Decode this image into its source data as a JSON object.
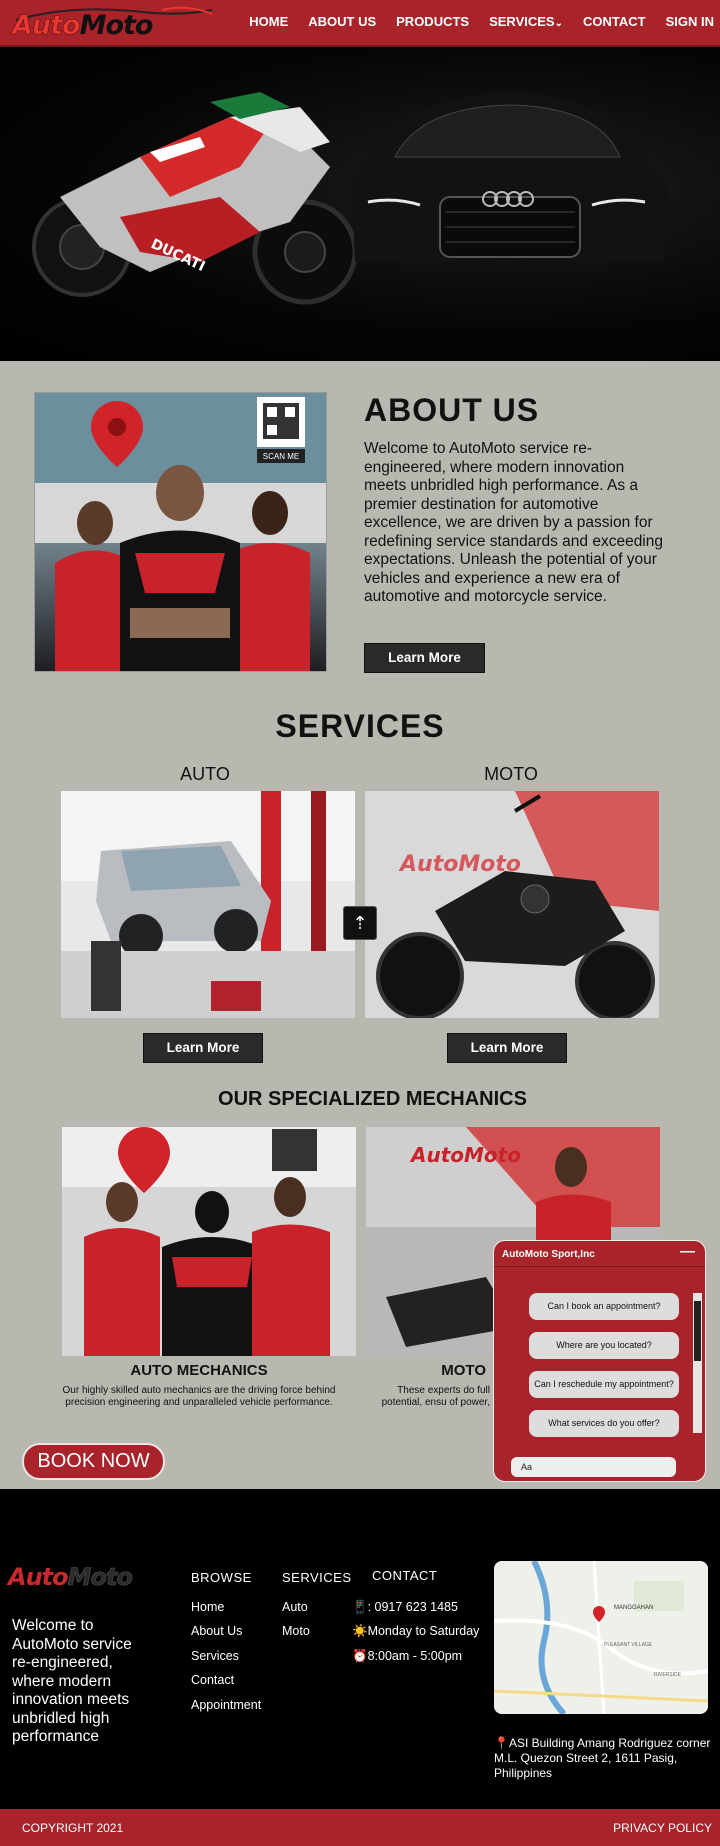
{
  "brand": {
    "part1": "Auto",
    "part2": "Moto"
  },
  "nav": {
    "items": [
      "HOME",
      "ABOUT US",
      "PRODUCTS",
      "SERVICES",
      "CONTACT",
      "SIGN IN"
    ],
    "services_caret": "⌄"
  },
  "about": {
    "title": "ABOUT US",
    "text": "Welcome to AutoMoto service re-engineered, where modern innovation meets unbridled high performance. As a premier destination for automotive excellence, we are driven by a passion for redefining service standards and exceeding expectations. Unleash the potential of your vehicles and experience a new era of automotive and motorcycle service.",
    "button": "Learn More",
    "photo_qr_label": "SCAN ME"
  },
  "services": {
    "title": "SERVICES",
    "items": [
      {
        "label": "AUTO",
        "button": "Learn More"
      },
      {
        "label": "MOTO",
        "button": "Learn More"
      }
    ],
    "scroll_top_icon": "⇡"
  },
  "mechanics": {
    "title": "OUR SPECIALIZED MECHANICS",
    "items": [
      {
        "name": "AUTO MECHANICS",
        "desc": "Our highly skilled auto mechanics are the driving force behind precision engineering and unparalleled vehicle performance."
      },
      {
        "name": "MOTO",
        "desc": "These experts do full potential, ensu of power,"
      }
    ]
  },
  "book_now": "BOOK NOW",
  "chat": {
    "title": "AutoMoto Sport,Inc",
    "minimize": "—",
    "questions": [
      "Can I book an appointment?",
      "Where are you located?",
      "Can I reschedule my appointment?",
      "What services do you offer?"
    ],
    "input_placeholder": "Aa"
  },
  "footer": {
    "welcome": "Welcome to AutoMoto service re-engineered, where modern innovation meets unbridled high performance",
    "browse": {
      "title": "BROWSE",
      "items": [
        "Home",
        "About Us",
        "Services",
        "Contact",
        "Appointment"
      ]
    },
    "services": {
      "title": "SERVICES",
      "items": [
        "Auto",
        "Moto"
      ]
    },
    "contact": {
      "title": "CONTACT",
      "phone": "📱: 0917 623 1485",
      "days": "☀️Monday to Saturday",
      "hours": "⏰8:00am - 5:00pm"
    },
    "map_labels": [
      "MANGGAHAN",
      "PLEASANT VILLAGE",
      "RIVERSIDE"
    ],
    "address": "📍ASI Building Amang Rodriguez corner M.L. Quezon Street 2, 1611 Pasig, Philippines",
    "copyright": "COPYRIGHT 2021",
    "privacy": "PRIVACY POLICY"
  },
  "colors": {
    "brand_red": "#a8232a",
    "footer_bg": "#000000",
    "page_bg": "#b9b8b0"
  }
}
